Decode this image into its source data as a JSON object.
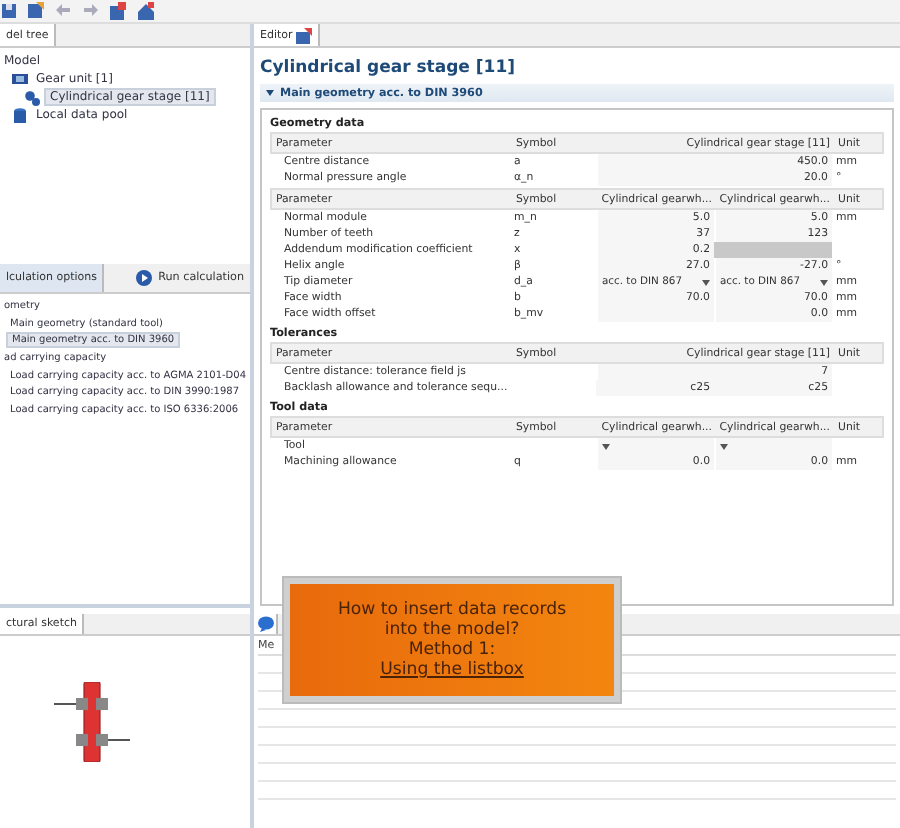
{
  "model_tree": {
    "tab": {
      "label": "del tree",
      "selected": true
    },
    "items": [
      {
        "label": "Model",
        "selected": false,
        "children": [
          {
            "label": "Gear unit [1]",
            "selected": false,
            "children": [
              {
                "label": "Cylindrical gear stage [11]",
                "selected": true
              }
            ]
          },
          {
            "label": "Local data pool",
            "selected": false
          }
        ]
      }
    ]
  },
  "calculation": {
    "tab": {
      "label": "lculation options",
      "selected": true
    },
    "run_button": "Run calculation",
    "items": [
      {
        "label": "ometry",
        "selected": false,
        "children": [
          {
            "label": "Main geometry (standard tool)",
            "selected": false
          },
          {
            "label": "Main geometry acc. to DIN 3960",
            "selected": true
          }
        ]
      },
      {
        "label": "ad carrying capacity",
        "selected": false,
        "children": [
          {
            "label": "Load carrying capacity acc. to AGMA 2101-D04",
            "selected": false
          },
          {
            "label": "Load carrying capacity acc. to DIN 3990:1987",
            "selected": false
          },
          {
            "label": "Load carrying capacity acc. to ISO 6336:2006",
            "selected": false
          }
        ]
      }
    ]
  },
  "sketch": {
    "tab": {
      "label": "ctural sketch",
      "selected": true
    }
  },
  "editor": {
    "tab": {
      "label": "Editor",
      "selected": true
    },
    "title": "Cylindrical gear stage [11]",
    "section": {
      "label": "Main geometry acc. to DIN 3960",
      "expanded": true
    },
    "groups": [
      {
        "title": "Geometry data",
        "tables": [
          {
            "columns": [
              "Parameter",
              "Symbol",
              "Cylindrical gear stage [11]",
              "Unit"
            ],
            "rows": [
              {
                "cells": [
                  {
                    "kind": "label",
                    "text": "Centre distance"
                  },
                  {
                    "kind": "label",
                    "text": "a"
                  },
                  {
                    "kind": "value",
                    "text": "450.0"
                  },
                  {
                    "kind": "label",
                    "text": "mm"
                  }
                ]
              },
              {
                "cells": [
                  {
                    "kind": "label",
                    "text": "Normal pressure angle"
                  },
                  {
                    "kind": "label",
                    "text": "α_n"
                  },
                  {
                    "kind": "value",
                    "text": "20.0"
                  },
                  {
                    "kind": "label",
                    "text": "°"
                  }
                ]
              }
            ]
          },
          {
            "columns": [
              "Parameter",
              "Symbol",
              "Cylindrical gearwh...",
              "Cylindrical gearwh...",
              "Unit"
            ],
            "rows": [
              {
                "cells": [
                  {
                    "kind": "label",
                    "text": "Normal module"
                  },
                  {
                    "kind": "label",
                    "text": "m_n"
                  },
                  {
                    "kind": "value",
                    "text": "5.0"
                  },
                  {
                    "kind": "value",
                    "text": "5.0"
                  },
                  {
                    "kind": "label",
                    "text": "mm"
                  }
                ]
              },
              {
                "cells": [
                  {
                    "kind": "label",
                    "text": "Number of teeth"
                  },
                  {
                    "kind": "label",
                    "text": "z"
                  },
                  {
                    "kind": "value",
                    "text": "37"
                  },
                  {
                    "kind": "value",
                    "text": "123"
                  },
                  {
                    "kind": "empty"
                  }
                ]
              },
              {
                "cells": [
                  {
                    "kind": "label",
                    "text": "Addendum modification coefficient"
                  },
                  {
                    "kind": "label",
                    "text": "x"
                  },
                  {
                    "kind": "value",
                    "text": "0.2"
                  },
                  {
                    "kind": "disabled"
                  },
                  {
                    "kind": "empty"
                  }
                ]
              },
              {
                "cells": [
                  {
                    "kind": "label",
                    "text": "Helix angle"
                  },
                  {
                    "kind": "label",
                    "text": "β"
                  },
                  {
                    "kind": "value",
                    "text": "27.0"
                  },
                  {
                    "kind": "value",
                    "text": "-27.0"
                  },
                  {
                    "kind": "label",
                    "text": "°"
                  }
                ]
              },
              {
                "cells": [
                  {
                    "kind": "label",
                    "text": "Tip diameter"
                  },
                  {
                    "kind": "label",
                    "text": "d_a"
                  },
                  {
                    "kind": "dropdown",
                    "text": "acc. to DIN 867"
                  },
                  {
                    "kind": "dropdown",
                    "text": "acc. to DIN 867"
                  },
                  {
                    "kind": "label",
                    "text": "mm"
                  }
                ]
              },
              {
                "cells": [
                  {
                    "kind": "label",
                    "text": "Face width"
                  },
                  {
                    "kind": "label",
                    "text": "b"
                  },
                  {
                    "kind": "value",
                    "text": "70.0"
                  },
                  {
                    "kind": "value",
                    "text": "70.0"
                  },
                  {
                    "kind": "label",
                    "text": "mm"
                  }
                ]
              },
              {
                "cells": [
                  {
                    "kind": "label",
                    "text": "Face width offset"
                  },
                  {
                    "kind": "label",
                    "text": "b_mv"
                  },
                  {
                    "kind": "blank"
                  },
                  {
                    "kind": "value",
                    "text": "0.0"
                  },
                  {
                    "kind": "label",
                    "text": "mm"
                  }
                ]
              }
            ]
          }
        ]
      },
      {
        "title": "Tolerances",
        "tables": [
          {
            "columns": [
              "Parameter",
              "Symbol",
              "Cylindrical gear stage [11]",
              "Unit"
            ],
            "rows": [
              {
                "cells": [
                  {
                    "kind": "label",
                    "text": "Centre distance: tolerance field js"
                  },
                  {
                    "kind": "empty"
                  },
                  {
                    "kind": "value",
                    "text": "7"
                  },
                  {
                    "kind": "empty"
                  }
                ]
              },
              {
                "cells": [
                  {
                    "kind": "label",
                    "text": "Backlash allowance and tolerance sequ..."
                  },
                  {
                    "kind": "empty"
                  },
                  {
                    "kind": "split",
                    "texts": [
                      "c25",
                      "c25"
                    ]
                  },
                  {
                    "kind": "empty"
                  }
                ]
              }
            ]
          }
        ]
      },
      {
        "title": "Tool data",
        "tables": [
          {
            "columns": [
              "Parameter",
              "Symbol",
              "Cylindrical gearwh...",
              "Cylindrical gearwh...",
              "Unit"
            ],
            "rows": [
              {
                "cells": [
                  {
                    "kind": "label",
                    "text": "Tool"
                  },
                  {
                    "kind": "empty"
                  },
                  {
                    "kind": "dropdown"
                  },
                  {
                    "kind": "dropdown"
                  },
                  {
                    "kind": "empty"
                  }
                ]
              },
              {
                "cells": [
                  {
                    "kind": "label",
                    "text": "Machining allowance"
                  },
                  {
                    "kind": "label",
                    "text": "q"
                  },
                  {
                    "kind": "value",
                    "text": "0.0"
                  },
                  {
                    "kind": "value",
                    "text": "0.0"
                  },
                  {
                    "kind": "label",
                    "text": "mm"
                  }
                ]
              }
            ]
          }
        ]
      }
    ]
  },
  "messages": {
    "column": "Me"
  },
  "overlay": {
    "lines": [
      "How to insert data records",
      "into the model?",
      "Method 1:"
    ],
    "link": "Using the listbox"
  }
}
